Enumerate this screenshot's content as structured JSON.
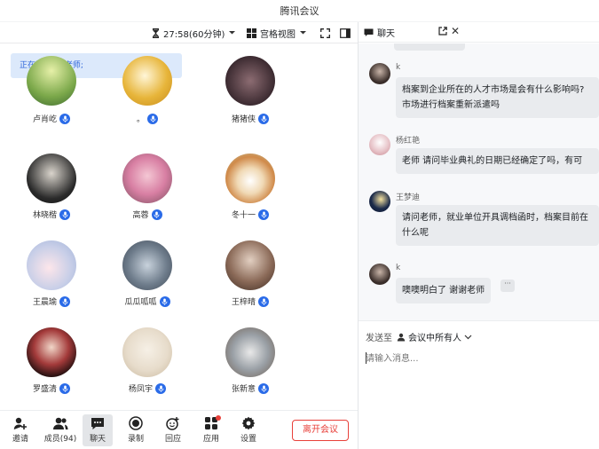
{
  "app": {
    "title": "腾讯会议"
  },
  "toolbar": {
    "timer": "27:58(60分钟)",
    "view_label": "宫格视图"
  },
  "speaking": {
    "text": "正在讲话: 刘老师;"
  },
  "participants": [
    {
      "name": "卢肖屹"
    },
    {
      "name": "。"
    },
    {
      "name": "猪猪侠"
    },
    {
      "name": "林晓楷"
    },
    {
      "name": "高蓉"
    },
    {
      "name": "冬十一"
    },
    {
      "name": "王晨瑜"
    },
    {
      "name": "瓜瓜呱呱"
    },
    {
      "name": "王梓晴"
    },
    {
      "name": "罗盛清"
    },
    {
      "name": "杨凤宇"
    },
    {
      "name": "张新意"
    }
  ],
  "bottombar": {
    "invite": "邀请",
    "members": "成员(94)",
    "chat": "聊天",
    "record": "录制",
    "reactions": "回应",
    "apps": "应用",
    "settings": "设置",
    "leave": "离开会议"
  },
  "chat": {
    "title": "聊天",
    "messages": [
      {
        "sender": "k",
        "lines": [
          "档案到企业所在的人才市场是会有什么影响吗?",
          "市场进行档案重新派遣吗"
        ]
      },
      {
        "sender": "杨红艳",
        "lines": [
          "老师 请问毕业典礼的日期已经确定了吗，有可"
        ]
      },
      {
        "sender": "王梦迪",
        "lines": [
          "请问老师，就业单位开具调档函时，档案目前在",
          "什么呢"
        ]
      },
      {
        "sender": "k",
        "lines": [
          "噢噢明白了 谢谢老师"
        ]
      }
    ],
    "more": "···",
    "send_to_label": "发送至",
    "send_to_target": "会议中所有人",
    "input_placeholder": "请输入消息..."
  },
  "colors": {
    "accent": "#2a6be8",
    "leave": "#e8403a",
    "speaking_bg": "#dce9fb"
  }
}
